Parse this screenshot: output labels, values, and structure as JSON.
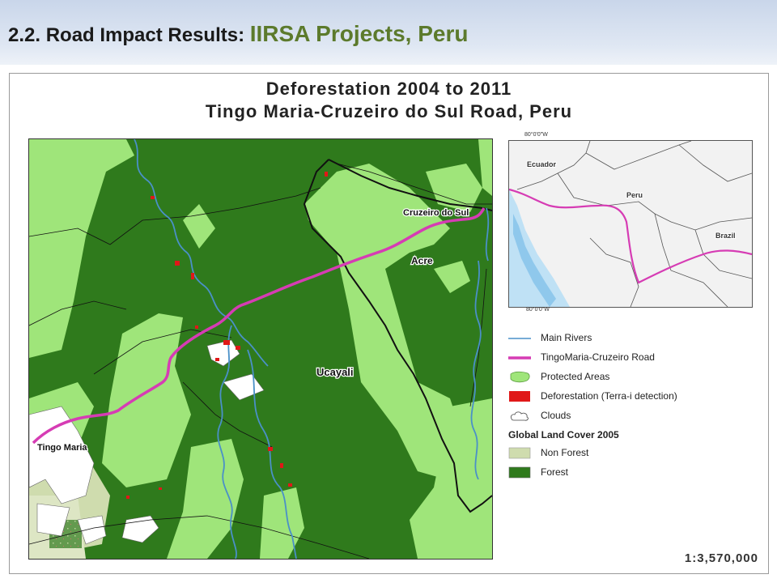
{
  "header": {
    "prefix": "2.2.  Road Impact Results: ",
    "subtitle": "IIRSA Projects, Peru"
  },
  "map": {
    "title_line1": "Deforestation 2004 to 2011",
    "title_line2": "Tingo Maria-Cruzeiro do Sul Road, Peru",
    "labels": {
      "cruzeiro": "Cruzeiro do Sul",
      "acre": "Acre",
      "ucayali": "Ucayali",
      "tingo": "Tingo Maria"
    }
  },
  "inset": {
    "coord_top": "80°0'0\"W",
    "coord_bottom": "80°0'0\"W",
    "labels": {
      "ecuador": "Ecuador",
      "peru": "Peru",
      "brazil": "Brazil"
    }
  },
  "legend": {
    "items": [
      {
        "label": "Main Rivers",
        "icon": "river-line",
        "color": "#4a90c8"
      },
      {
        "label": "TingoMaria-Cruzeiro Road",
        "icon": "road-line",
        "color": "#d63cb4"
      },
      {
        "label": "Protected Areas",
        "icon": "protected-area-swatch",
        "color": "#9fe57a"
      },
      {
        "label": "Deforestation (Terra-i detection)",
        "icon": "deforestation-swatch",
        "color": "#e01818"
      },
      {
        "label": "Clouds",
        "icon": "cloud-outline",
        "color": "#ffffff"
      }
    ],
    "land_cover_title": "Global Land Cover 2005",
    "land_cover": [
      {
        "label": "Non Forest",
        "icon": "non-forest-swatch",
        "color": "#cfdcae"
      },
      {
        "label": "Forest",
        "icon": "forest-swatch",
        "color": "#2f7a1c"
      }
    ]
  },
  "scale": "1:3,570,000",
  "colors": {
    "forest": "#2f7a1c",
    "protected": "#9fe57a",
    "road": "#d63cb4",
    "river": "#4a90c8",
    "deforestation": "#e01818",
    "header_subtitle": "#5c7a2c"
  }
}
